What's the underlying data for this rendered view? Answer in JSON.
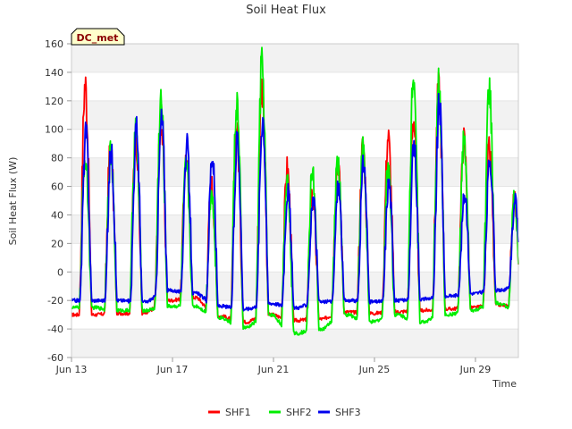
{
  "chart_data": {
    "type": "line",
    "title": "Soil Heat Flux",
    "xlabel": "Time",
    "ylabel": "Soil Heat Flux (W)",
    "badge": "DC_met",
    "ylim": [
      -60,
      160
    ],
    "yticks": [
      -60,
      -40,
      -20,
      0,
      20,
      40,
      60,
      80,
      100,
      120,
      140,
      160
    ],
    "xlim": [
      0,
      17.7
    ],
    "xticks": [
      {
        "value": 0,
        "label": "Jun 13"
      },
      {
        "value": 4,
        "label": "Jun 17"
      },
      {
        "value": 8,
        "label": "Jun 21"
      },
      {
        "value": 12,
        "label": "Jun 25"
      },
      {
        "value": 16,
        "label": "Jun 29"
      }
    ],
    "legend_position": "bottom-center",
    "grid": "alternating horizontal bands",
    "days": [
      "Jun 13",
      "Jun 14",
      "Jun 15",
      "Jun 16",
      "Jun 17",
      "Jun 18",
      "Jun 19",
      "Jun 20",
      "Jun 21",
      "Jun 22",
      "Jun 23",
      "Jun 24",
      "Jun 25",
      "Jun 26",
      "Jun 27",
      "Jun 28",
      "Jun 29",
      "Jun 30"
    ],
    "series": [
      {
        "name": "SHF1",
        "color": "#ff0000",
        "daily_max": [
          132,
          88,
          95,
          105,
          80,
          62,
          100,
          130,
          73,
          55,
          78,
          89,
          95,
          108,
          128,
          93,
          85,
          52
        ],
        "daily_min": [
          -30,
          -29,
          -29,
          -20,
          -18,
          -31,
          -35,
          -30,
          -34,
          -33,
          -28,
          -29,
          -28,
          -27,
          -26,
          -25,
          -23,
          -25
        ]
      },
      {
        "name": "SHF2",
        "color": "#00ee00",
        "daily_max": [
          80,
          85,
          100,
          120,
          75,
          55,
          119,
          146,
          67,
          73,
          78,
          87,
          75,
          145,
          130,
          90,
          127,
          52
        ],
        "daily_min": [
          -25,
          -27,
          -27,
          -24,
          -24,
          -32,
          -39,
          -30,
          -43,
          -40,
          -30,
          -35,
          -30,
          -35,
          -30,
          -27,
          -22,
          -28
        ]
      },
      {
        "name": "SHF3",
        "color": "#0000ee",
        "daily_max": [
          97,
          85,
          100,
          107,
          88,
          82,
          95,
          110,
          57,
          50,
          60,
          77,
          63,
          90,
          118,
          55,
          80,
          50
        ],
        "daily_min": [
          -20,
          -20,
          -21,
          -13,
          -15,
          -24,
          -26,
          -22,
          -25,
          -21,
          -20,
          -21,
          -20,
          -19,
          -17,
          -15,
          -13,
          -10
        ]
      }
    ]
  }
}
